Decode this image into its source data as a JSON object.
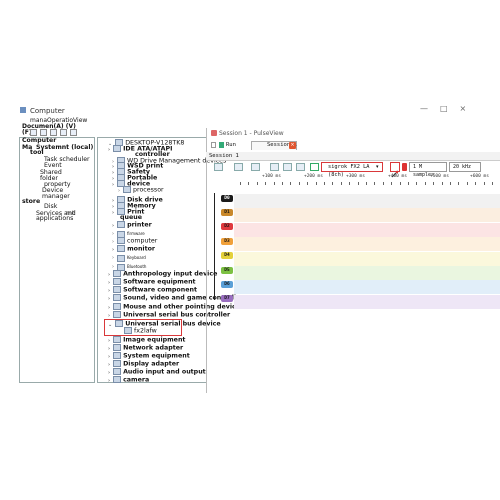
{
  "computer_management": {
    "title": "Computer",
    "menu": {
      "line1": "manaOperatioView",
      "line2": "Documen(A)   (V)",
      "line3": "(F)"
    },
    "tree": [
      {
        "label": "Computer",
        "bold": true
      },
      {
        "label": "Ma",
        "bold": true
      },
      {
        "label": "Systemnt (local)",
        "bold": true
      },
      {
        "label": "tool",
        "bold": true
      },
      {
        "label": "Task scheduler"
      },
      {
        "label": "Event"
      },
      {
        "label": "Shared"
      },
      {
        "label": "folder"
      },
      {
        "label": "property"
      },
      {
        "label": "Device"
      },
      {
        "label": "manager"
      },
      {
        "label": "store",
        "bold": true
      },
      {
        "label": "Disk"
      },
      {
        "label": "Services and"
      },
      {
        "label": "mt"
      },
      {
        "label": "applications"
      }
    ],
    "devices": [
      {
        "label": "DESKTOP-V128TK8"
      },
      {
        "label": "IDE ATA/ATAPI",
        "bold": true
      },
      {
        "label": "controller",
        "bold": true
      },
      {
        "label": "WD Drive Management devices"
      },
      {
        "label": "WSD print",
        "bold": true
      },
      {
        "label": "Safety",
        "bold": true
      },
      {
        "label": "Portable",
        "bold": true
      },
      {
        "label": "device",
        "bold": true
      },
      {
        "label": "processor"
      },
      {
        "label": "Disk drive",
        "bold": true
      },
      {
        "label": "Memory",
        "bold": true
      },
      {
        "label": "Print",
        "bold": true
      },
      {
        "label": "queue",
        "bold": true
      },
      {
        "label": "printer",
        "bold": true
      },
      {
        "label": "firmware",
        "small": true
      },
      {
        "label": "computer"
      },
      {
        "label": "monitor",
        "bold": true
      },
      {
        "label": "Keyboard",
        "small": true
      },
      {
        "label": "Bluetooth",
        "small": true
      },
      {
        "label": "Anthropology input device",
        "bold": true
      },
      {
        "label": "Software equipment",
        "bold": true
      },
      {
        "label": "Software component",
        "bold": true
      },
      {
        "label": "Sound, video and game controllers",
        "bold": true
      },
      {
        "label": "Mouse and other pointing devices",
        "bold": true
      },
      {
        "label": "Universal serial bus controller",
        "bold": true
      },
      {
        "label": "Universal serial bus device",
        "bold": true
      },
      {
        "label": "fx2lafw"
      },
      {
        "label": "Image equipment",
        "bold": true
      },
      {
        "label": "Network adapter",
        "bold": true
      },
      {
        "label": "System equipment",
        "bold": true
      },
      {
        "label": "Display adapter",
        "bold": true
      },
      {
        "label": "Audio input and output",
        "bold": true
      },
      {
        "label": "camera",
        "bold": true
      }
    ]
  },
  "pulseview": {
    "title": "Session 1 - PulseView",
    "tabs": {
      "run": "Run",
      "session": "Session 1",
      "close": "×"
    },
    "session_label": "Session 1",
    "device": "sigrok FX2 LA (8ch)",
    "samples": "1 M samples",
    "samplerate": "20 kHz",
    "ruler": [
      "+100 ms",
      "+200 ms",
      "+300 ms",
      "+400 ms",
      "+500 ms",
      "+600 ms"
    ],
    "channels": [
      {
        "label": "D0",
        "color": "#1a1a1a",
        "lane": "#f1f1f1",
        "text": "#ffffff"
      },
      {
        "label": "D1",
        "color": "#c9882a",
        "lane": "#fbeee0",
        "text": "#111111"
      },
      {
        "label": "D2",
        "color": "#e0393e",
        "lane": "#fce4e4",
        "text": "#111111"
      },
      {
        "label": "D3",
        "color": "#f0a03a",
        "lane": "#fdf0df",
        "text": "#111111"
      },
      {
        "label": "D4",
        "color": "#e4d13a",
        "lane": "#fbf8dc",
        "text": "#111111"
      },
      {
        "label": "D5",
        "color": "#7cc142",
        "lane": "#eaf6e0",
        "text": "#111111"
      },
      {
        "label": "D6",
        "color": "#5aa0d8",
        "lane": "#e1eef9",
        "text": "#111111"
      },
      {
        "label": "D7",
        "color": "#9a6fc0",
        "lane": "#eee6f6",
        "text": "#111111"
      }
    ],
    "window_controls": "—□×"
  }
}
